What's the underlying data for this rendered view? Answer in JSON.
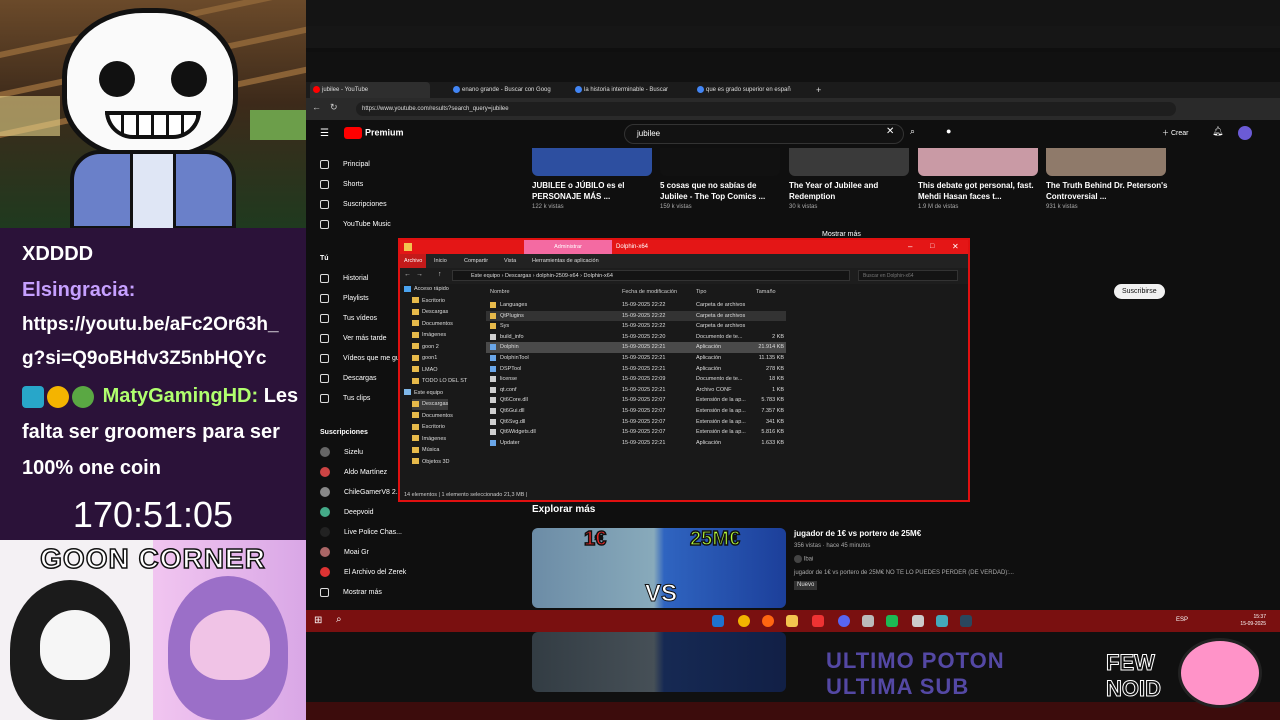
{
  "chat": {
    "line1": "XDDDD",
    "user1": "Elsingracia:",
    "msg1": "https://youtu.be/aFc2Or63h_g?si=Q9oBHdv3Z5nbHQYc",
    "user2": "MatyGamingHD:",
    "msg2a": "Les",
    "msg2b": "falta ser groomers para ser",
    "msg2c": "100% one coin"
  },
  "timer": "170:51:05",
  "goon_title": "GOON CORNER",
  "browser": {
    "tabs": [
      {
        "label": "jubilee - YouTube"
      },
      {
        "label": "enano grande - Buscar con Goog"
      },
      {
        "label": "la historia interminable - Buscar"
      },
      {
        "label": "que es grado superior en españ"
      }
    ],
    "url": "https://www.youtube.com/results?search_query=jubilee"
  },
  "youtube": {
    "logo": "Premium",
    "search_value": "jubilee",
    "create": "Crear",
    "sidebar": [
      "Principal",
      "Shorts",
      "Suscripciones",
      "YouTube Music",
      "Tú",
      "Historial",
      "Playlists",
      "Tus vídeos",
      "Ver más tarde",
      "Vídeos que me gu",
      "Descargas",
      "Tus clips",
      "Suscripciones",
      "Sizelu",
      "Aldo Martínez",
      "ChileGamerV8 2...",
      "Deepvoid",
      "Live Police Chas...",
      "Moai Gr",
      "El Archivo del Zerek",
      "Mostrar más"
    ],
    "videos": [
      {
        "title": "JUBILEE o JÚBILO es el PERSONAJE MÁS ...",
        "meta": "122 k vistas"
      },
      {
        "title": "5 cosas que no sabías de Jubilee - The Top Comics ...",
        "meta": "159 k vistas"
      },
      {
        "title": "The Year of Jubilee and Redemption",
        "meta": "30 k vistas"
      },
      {
        "title": "This debate got personal, fast. Mehdi Hasan faces t...",
        "meta": "1.9 M de vistas"
      },
      {
        "title": "The Truth Behind Dr. Peterson's Controversial ...",
        "meta": "931 k vistas"
      }
    ],
    "mostrar_mas": "Mostrar más",
    "subscribe": "Suscribirse",
    "explore": "Explorar más",
    "featured": {
      "title": "jugador de 1€ vs portero de 25M€",
      "views": "356 vistas · hace 45 minutos",
      "channel": "Ibai",
      "desc": "jugador de 1€ vs portero de 25M€ NO TE LO PUEDES PERDER (DE VERDAD):...",
      "badge": "Nuevo",
      "thumb_left": "1€",
      "thumb_right": "25M€",
      "thumb_vs": "VS"
    }
  },
  "explorer": {
    "title": "Dolphin-x64",
    "context_tab": "Administrar",
    "ribbon": [
      "Archivo",
      "Inicio",
      "Compartir",
      "Vista",
      "Herramientas de aplicación"
    ],
    "breadcrumb": [
      "Este equipo",
      "Descargas",
      "dolphin-2509-x64",
      "Dolphin-x64"
    ],
    "search_placeholder": "Buscar en Dolphin-x64",
    "headers": [
      "Nombre",
      "Fecha de modificación",
      "Tipo",
      "Tamaño"
    ],
    "nav": [
      "Acceso rápido",
      "Escritorio",
      "Descargas",
      "Documentos",
      "Imágenes",
      "goon 2",
      "goon1",
      "LMAO",
      "TODO LO DEL ST",
      "Este equipo",
      "Descargas",
      "Documentos",
      "Escritorio",
      "Imágenes",
      "Música",
      "Objetos 3D"
    ],
    "files": [
      {
        "name": "Languages",
        "date": "15-09-2025 22:22",
        "type": "Carpeta de archivos",
        "size": ""
      },
      {
        "name": "QtPlugins",
        "date": "15-09-2025 22:22",
        "type": "Carpeta de archivos",
        "size": ""
      },
      {
        "name": "Sys",
        "date": "15-09-2025 22:22",
        "type": "Carpeta de archivos",
        "size": ""
      },
      {
        "name": "build_info",
        "date": "15-09-2025 22:20",
        "type": "Documento de te...",
        "size": "2 KB"
      },
      {
        "name": "Dolphin",
        "date": "15-09-2025 22:21",
        "type": "Aplicación",
        "size": "21.914 KB"
      },
      {
        "name": "DolphinTool",
        "date": "15-09-2025 22:21",
        "type": "Aplicación",
        "size": "11.135 KB"
      },
      {
        "name": "DSPTool",
        "date": "15-09-2025 22:21",
        "type": "Aplicación",
        "size": "278 KB"
      },
      {
        "name": "license",
        "date": "15-09-2025 22:09",
        "type": "Documento de te...",
        "size": "18 KB"
      },
      {
        "name": "qt.conf",
        "date": "15-09-2025 22:21",
        "type": "Archivo CONF",
        "size": "1 KB"
      },
      {
        "name": "Qt6Core.dll",
        "date": "15-09-2025 22:07",
        "type": "Extensión de la ap...",
        "size": "5.783 KB"
      },
      {
        "name": "Qt6Gui.dll",
        "date": "15-09-2025 22:07",
        "type": "Extensión de la ap...",
        "size": "7.357 KB"
      },
      {
        "name": "Qt6Svg.dll",
        "date": "15-09-2025 22:07",
        "type": "Extensión de la ap...",
        "size": "341 KB"
      },
      {
        "name": "Qt6Widgets.dll",
        "date": "15-09-2025 22:07",
        "type": "Extensión de la ap...",
        "size": "5.816 KB"
      },
      {
        "name": "Updater",
        "date": "15-09-2025 22:21",
        "type": "Aplicación",
        "size": "1.633 KB"
      }
    ],
    "status": "14 elementos  |  1 elemento seleccionado  21,3 MB  |"
  },
  "taskbar": {
    "lang": "ESP",
    "time": "15:37",
    "date": "15-09-2025"
  },
  "overlay": {
    "ultimo1": "ULTIMO POTON",
    "ultimo2": "ULTIMA SUB",
    "few1": "FEW",
    "few2": "NOID"
  },
  "colors": {
    "accent_red": "#e41616",
    "yt_red": "#ff0000",
    "chat_bg": "#2b1239"
  }
}
